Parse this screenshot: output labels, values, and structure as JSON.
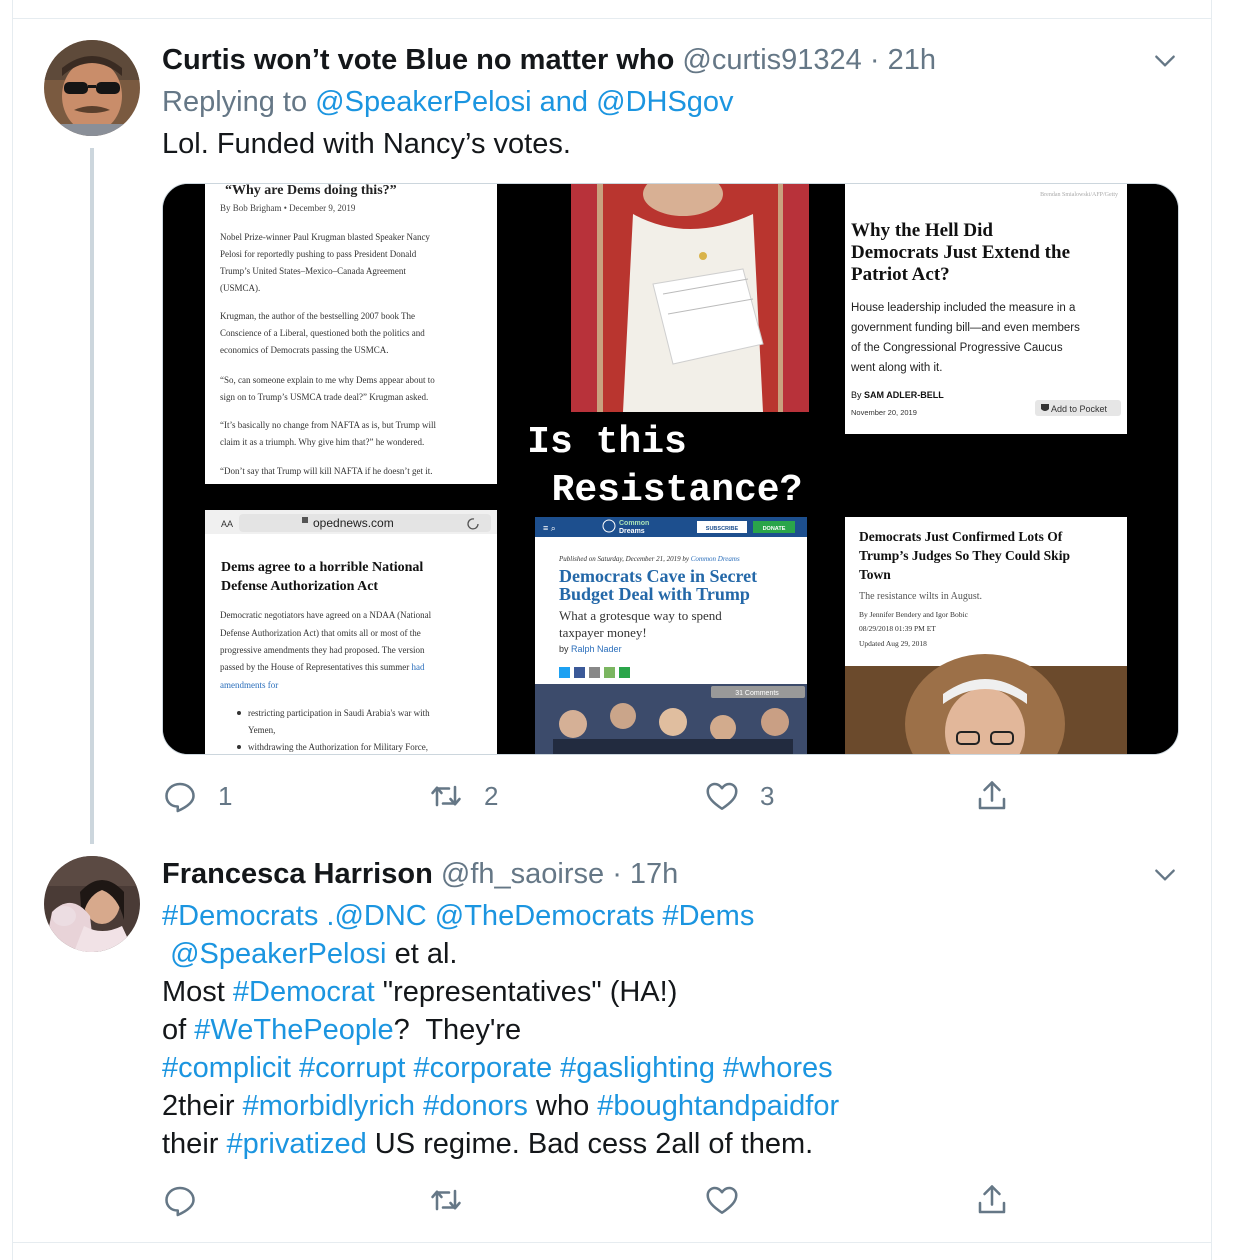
{
  "tweet1": {
    "display_name": "Curtis won’t vote Blue no matter who",
    "handle": "@curtis91324",
    "separator": "·",
    "time": "21h",
    "replying_label": "Replying to",
    "reply_mention_1": "@SpeakerPelosi",
    "reply_and": "and",
    "reply_mention_2": "@DHSgov",
    "text": "Lol. Funded with Nancy’s votes.",
    "media": {
      "topleft": {
        "headline": "“Why are Dems doing this?”",
        "byline": "By Bob Brigham • December 9, 2019",
        "p1": [
          "Nobel Prize-winner Paul Krugman blasted Speaker Nancy",
          "Pelosi for reportedly pushing to pass President Donald",
          "Trump’s United States–Mexico–Canada Agreement",
          "(USMCA)."
        ],
        "p2": [
          "Krugman, the author of the bestselling 2007 book The",
          "Conscience of a Liberal, questioned both the politics and",
          "economics of Democrats passing the USMCA."
        ],
        "p3": [
          "“So, can someone explain to me why Dems appear about to",
          "sign on to Trump’s USMCA trade deal?” Krugman asked."
        ],
        "p4": [
          "“It’s basically no change from NAFTA as is, but Trump will",
          "claim it as a triumph. Why give him that?” he wondered."
        ],
        "p5": [
          "“Don’t say that Trump will kill NAFTA if he doesn’t get it."
        ]
      },
      "topright": {
        "credit": "Brendan Smialowski/AFP/Getty",
        "headline": [
          "Why the Hell Did",
          "Democrats Just Extend the",
          "Patriot Act?"
        ],
        "body": [
          "House leadership included the measure in a",
          "government funding bill—and even members",
          "of the Congressional Progressive Caucus",
          "went along with it."
        ],
        "byline_by": "By",
        "byline_author": "SAM ADLER-BELL",
        "date": "November 20, 2019",
        "pocket": "Add to Pocket"
      },
      "center_caption": [
        "Is this",
        "Resistance?"
      ],
      "bottomleft": {
        "aa": "AA",
        "url": "opednews.com",
        "headline": [
          "Dems agree to a horrible National",
          "Defense Authorization Act"
        ],
        "body": [
          "Democratic negotiators have agreed on a NDAA (National",
          "Defense Authorization Act) that omits all or most of the",
          "progressive amendments they had proposed. The version"
        ],
        "body_last": "passed by the House of Representatives this summer",
        "body_link_1": "had",
        "body_link_2": "amendments for",
        "bullets": [
          [
            "restricting participation in Saudi Arabia's war with",
            "Yemen,"
          ],
          [
            "withdrawing the Authorization for Military Force,"
          ]
        ]
      },
      "bottomcenter": {
        "logo_1": "Common",
        "logo_2": "Dreams",
        "subscribe": "SUBSCRIBE",
        "donate": "DONATE",
        "published": "Published on Saturday, December 21, 2019 by",
        "published_src": "Common Dreams",
        "headline": [
          "Democrats Cave in Secret",
          "Budget Deal with Trump"
        ],
        "dek": [
          "What a grotesque way to spend",
          "taxpayer money!"
        ],
        "by": "by",
        "author": "Ralph Nader",
        "comments": "31 Comments"
      },
      "bottomright": {
        "headline": [
          "Democrats Just Confirmed Lots Of",
          "Trump’s Judges So They Could Skip",
          "Town"
        ],
        "dek": "The resistance wilts in August.",
        "byline": "By Jennifer Bendery and Igor Bobic",
        "time": "08/29/2018 01:39 PM ET",
        "updated": "Updated Aug 29, 2018"
      }
    },
    "actions": {
      "reply_count": "1",
      "retweet_count": "2",
      "like_count": "3"
    }
  },
  "tweet2": {
    "display_name": "Francesca Harrison",
    "handle": "@fh_saoirse",
    "separator": "·",
    "time": "17h",
    "lines": [
      [
        {
          "t": "#Democrats",
          "link": true
        },
        {
          "t": " ",
          "link": false
        },
        {
          "t": ".@DNC",
          "link": true
        },
        {
          "t": " ",
          "link": false
        },
        {
          "t": "@TheDemocrats",
          "link": true
        },
        {
          "t": " ",
          "link": false
        },
        {
          "t": "#Dems",
          "link": true
        }
      ],
      [
        {
          "t": " ",
          "link": false
        },
        {
          "t": "@SpeakerPelosi",
          "link": true
        },
        {
          "t": " et al.",
          "link": false
        }
      ],
      [
        {
          "t": "Most ",
          "link": false
        },
        {
          "t": "#Democrat",
          "link": true
        },
        {
          "t": " \"representatives\" (HA!)",
          "link": false
        }
      ],
      [
        {
          "t": "of ",
          "link": false
        },
        {
          "t": "#WeThePeople",
          "link": true
        },
        {
          "t": "?  They're",
          "link": false
        }
      ],
      [
        {
          "t": "#complicit",
          "link": true
        },
        {
          "t": " ",
          "link": false
        },
        {
          "t": "#corrupt",
          "link": true
        },
        {
          "t": " ",
          "link": false
        },
        {
          "t": "#corporate",
          "link": true
        },
        {
          "t": " ",
          "link": false
        },
        {
          "t": "#gaslighting",
          "link": true
        },
        {
          "t": " ",
          "link": false
        },
        {
          "t": "#whores",
          "link": true
        }
      ],
      [
        {
          "t": "2their ",
          "link": false
        },
        {
          "t": "#morbidlyrich",
          "link": true
        },
        {
          "t": " ",
          "link": false
        },
        {
          "t": "#donors",
          "link": true
        },
        {
          "t": " who ",
          "link": false
        },
        {
          "t": "#boughtandpaidfor",
          "link": true
        }
      ],
      [
        {
          "t": "their ",
          "link": false
        },
        {
          "t": "#privatized",
          "link": true
        },
        {
          "t": " US regime. Bad cess 2all of them.",
          "link": false
        }
      ]
    ]
  },
  "colors": {
    "link": "#1b95e0",
    "secondary": "#657786",
    "text": "#14171a",
    "border": "#e6ecf0",
    "thread": "#ccd6dd"
  },
  "icons": [
    "reply-icon",
    "retweet-icon",
    "like-icon",
    "share-icon",
    "chevron-down-icon"
  ]
}
